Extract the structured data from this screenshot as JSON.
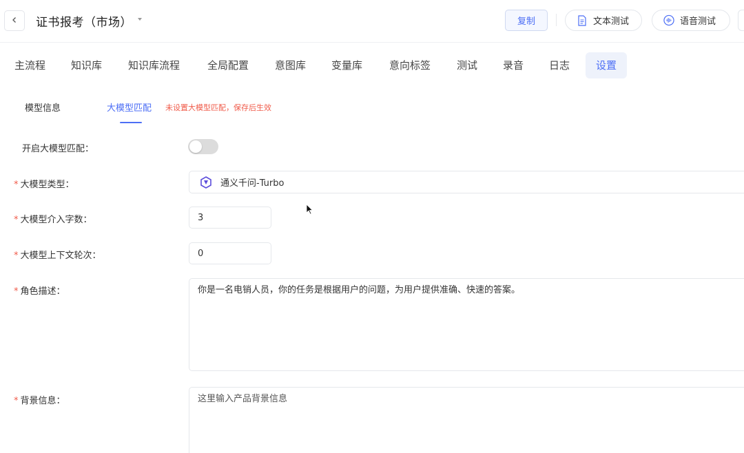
{
  "header": {
    "back_icon": "chevron-left-icon",
    "title": "证书报考（市场）",
    "copy_label": "复制",
    "text_test_label": "文本测试",
    "voice_test_label": "语音测试"
  },
  "tabs": [
    {
      "label": "主流程"
    },
    {
      "label": "知识库"
    },
    {
      "label": "知识库流程"
    },
    {
      "label": "全局配置"
    },
    {
      "label": "意图库"
    },
    {
      "label": "变量库"
    },
    {
      "label": "意向标签"
    },
    {
      "label": "测试"
    },
    {
      "label": "录音"
    },
    {
      "label": "日志"
    },
    {
      "label": "设置",
      "active": true
    }
  ],
  "subtabs": {
    "model_info": "模型信息",
    "llm_match": "大模型匹配",
    "note": "未设置大模型匹配，保存后生效"
  },
  "form": {
    "enable_label": "开启大模型匹配：",
    "enable_value": false,
    "model_type_label": "大模型类型：",
    "model_type_value": "通义千问-Turbo",
    "chars_label": "大模型介入字数：",
    "chars_value": "3",
    "context_label": "大模型上下文轮次：",
    "context_value": "0",
    "role_label": "角色描述：",
    "role_value": "你是一名电销人员，你的任务是根据用户的问题，为用户提供准确、快速的答案。",
    "background_label": "背景信息：",
    "background_placeholder": "这里输入产品背景信息"
  },
  "colors": {
    "accent": "#4c6ef5",
    "required": "#f05b4a",
    "active_tab_bg": "#eef2fb"
  }
}
